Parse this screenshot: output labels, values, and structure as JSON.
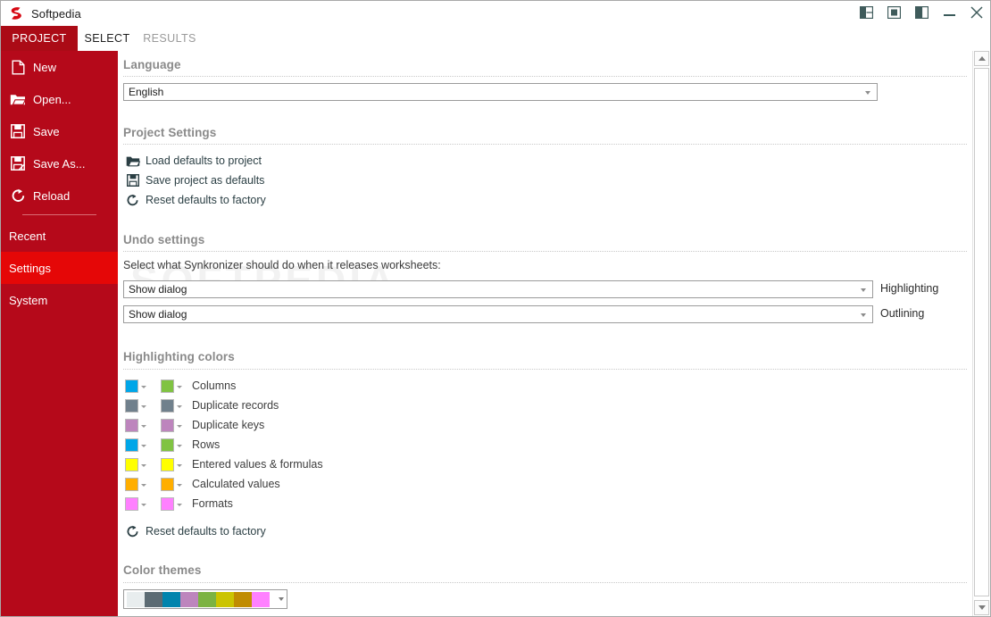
{
  "window": {
    "title": "Softpedia",
    "logo_icon": "softpedia-s-logo",
    "controls": [
      {
        "name": "layout-left-pane-icon"
      },
      {
        "name": "layout-center-pane-icon"
      },
      {
        "name": "layout-right-pane-icon"
      },
      {
        "name": "minimize-button"
      },
      {
        "name": "close-button"
      }
    ],
    "ribbon": {
      "split_view_icon": "split-columns-icon",
      "dropdown_icon": "chevron-down-icon",
      "collapse_icon": "chevron-up-icon"
    }
  },
  "tabs": [
    {
      "label": "PROJECT",
      "state": "active"
    },
    {
      "label": "SELECT",
      "state": "normal"
    },
    {
      "label": "RESULTS",
      "state": "dim"
    }
  ],
  "sidebar": {
    "items": [
      {
        "label": "New",
        "icon": "new-file-icon",
        "selected": false
      },
      {
        "label": "Open...",
        "icon": "open-folder-icon",
        "selected": false
      },
      {
        "label": "Save",
        "icon": "save-floppy-icon",
        "selected": false
      },
      {
        "label": "Save As...",
        "icon": "save-as-floppy-icon",
        "selected": false
      },
      {
        "label": "Reload",
        "icon": "reload-refresh-icon",
        "selected": false
      }
    ],
    "groups": [
      {
        "label": "Recent",
        "selected": false
      },
      {
        "label": "Settings",
        "selected": true
      },
      {
        "label": "System",
        "selected": false
      }
    ]
  },
  "content": {
    "watermark": "SOFTPEDIA",
    "language": {
      "heading": "Language",
      "value": "English"
    },
    "project_settings": {
      "heading": "Project Settings",
      "links": [
        {
          "label": "Load defaults to project",
          "icon": "open-folder-icon"
        },
        {
          "label": "Save project as defaults",
          "icon": "save-floppy-icon"
        },
        {
          "label": "Reset defaults to factory",
          "icon": "reload-refresh-icon"
        }
      ]
    },
    "undo_settings": {
      "heading": "Undo settings",
      "hint": "Select what Synkronizer should do when it releases worksheets:",
      "rows": [
        {
          "value": "Show dialog",
          "label": "Highlighting"
        },
        {
          "value": "Show dialog",
          "label": "Outlining"
        }
      ]
    },
    "highlighting_colors": {
      "heading": "Highlighting colors",
      "rows": [
        {
          "label": "Columns",
          "color1": "#00a6e8",
          "color2": "#80c342"
        },
        {
          "label": "Duplicate records",
          "color1": "#70808c",
          "color2": "#70808c"
        },
        {
          "label": "Duplicate keys",
          "color1": "#bd85bd",
          "color2": "#bd85bd"
        },
        {
          "label": "Rows",
          "color1": "#00a6e8",
          "color2": "#80c342"
        },
        {
          "label": "Entered values & formulas",
          "color1": "#ffff00",
          "color2": "#ffff00"
        },
        {
          "label": "Calculated values",
          "color1": "#ffae00",
          "color2": "#ffae00"
        },
        {
          "label": "Formats",
          "color1": "#ff80ff",
          "color2": "#ff80ff"
        }
      ],
      "reset_link": {
        "label": "Reset defaults to factory",
        "icon": "reload-refresh-icon"
      }
    },
    "color_themes": {
      "heading": "Color themes",
      "swatches": [
        "#e8edee",
        "#5c6b73",
        "#0084ad",
        "#bd85bd",
        "#7cb342",
        "#cbc400",
        "#c08c00",
        "#ff80ff"
      ]
    }
  },
  "colors": {
    "sidebar_red": "#b5091a",
    "tab_red": "#ab0b16",
    "selected_red": "#e50707",
    "heading_gray": "#8a8a8a"
  }
}
